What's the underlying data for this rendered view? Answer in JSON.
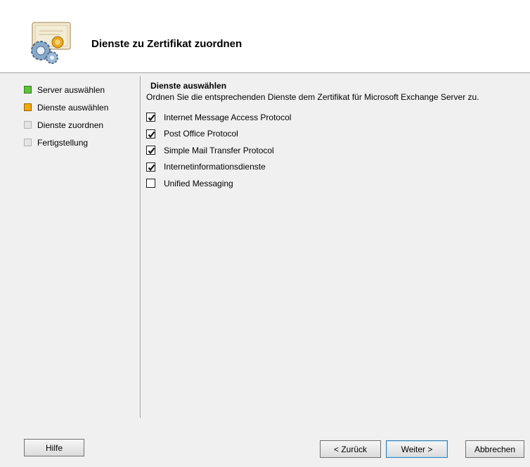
{
  "header": {
    "title": "Dienste zu Zertifikat zuordnen",
    "icon": "certificate-gear-icon"
  },
  "steps": [
    {
      "label": "Server auswählen",
      "state": "done"
    },
    {
      "label": "Dienste auswählen",
      "state": "current"
    },
    {
      "label": "Dienste zuordnen",
      "state": "pending"
    },
    {
      "label": "Fertigstellung",
      "state": "pending"
    }
  ],
  "content": {
    "title": "Dienste auswählen",
    "description": "Ordnen Sie die entsprechenden Dienste dem Zertifikat für Microsoft Exchange Server zu.",
    "options": [
      {
        "label": "Internet Message Access Protocol",
        "checked": true
      },
      {
        "label": "Post Office Protocol",
        "checked": true
      },
      {
        "label": "Simple Mail Transfer Protocol",
        "checked": true
      },
      {
        "label": "Internetinformationsdienste",
        "checked": true
      },
      {
        "label": "Unified Messaging",
        "checked": false
      }
    ]
  },
  "buttons": {
    "help": "Hilfe",
    "back": "< Zurück",
    "next": "Weiter >",
    "cancel": "Abbrechen"
  }
}
